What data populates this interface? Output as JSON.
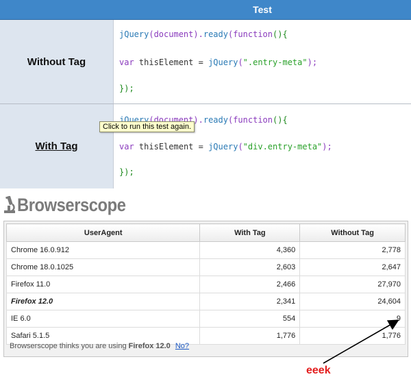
{
  "test_table": {
    "header": "Test",
    "rows": [
      {
        "label": "Without Tag",
        "code": {
          "line1": "jQuery(document).ready(function(){",
          "line2_prefix": "var thisElement = jQuery(",
          "line2_string": "\".entry-meta\"",
          "line2_suffix": ");",
          "line3": "});"
        }
      },
      {
        "label": "With Tag",
        "code": {
          "line1": "jQuery(document).ready(function(){",
          "line2_prefix": "var thisElement = jQuery(",
          "line2_string": "\"div.entry-meta\"",
          "line2_suffix": ");",
          "line3": "});"
        }
      }
    ],
    "tooltip": "Click to run this test again."
  },
  "browserscope": {
    "logo_text": "Browserscope",
    "columns": [
      "UserAgent",
      "With Tag",
      "Without Tag"
    ],
    "rows": [
      {
        "ua": "Chrome 16.0.912",
        "with_tag": "4,360",
        "without_tag": "2,778"
      },
      {
        "ua": "Chrome 18.0.1025",
        "with_tag": "2,603",
        "without_tag": "2,647"
      },
      {
        "ua": "Firefox 11.0",
        "with_tag": "2,466",
        "without_tag": "27,970"
      },
      {
        "ua": "Firefox 12.0",
        "with_tag": "2,341",
        "without_tag": "24,604",
        "current": true
      },
      {
        "ua": "IE 6.0",
        "with_tag": "554",
        "without_tag": "9"
      },
      {
        "ua": "Safari 5.1.5",
        "with_tag": "1,776",
        "without_tag": "1,776"
      }
    ],
    "footer_prefix": "Browserscope thinks you are using",
    "footer_browser": "Firefox 12.0",
    "footer_link": "No?"
  },
  "annotation": {
    "text": "eeek",
    "color": "#e31e1e"
  },
  "colors": {
    "header_blue": "#3f87c9",
    "label_bg": "#dde5ef"
  }
}
